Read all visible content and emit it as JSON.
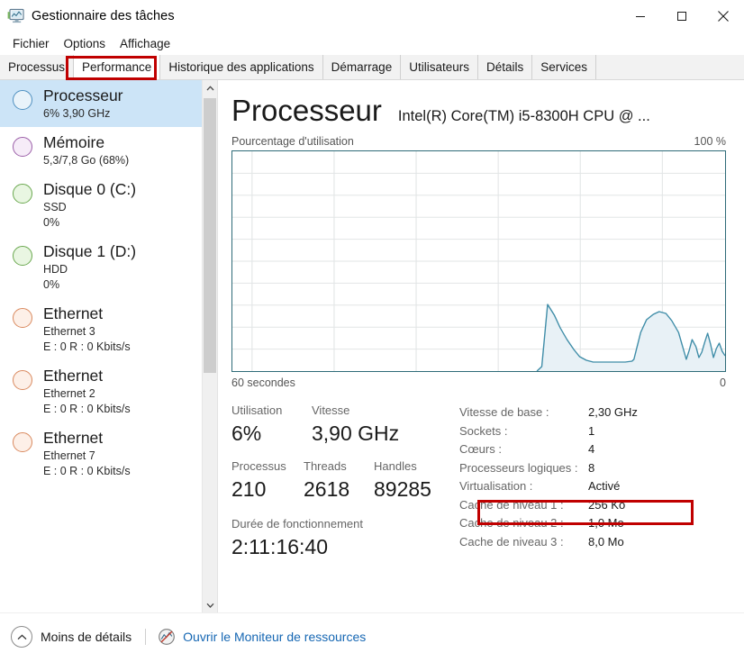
{
  "window": {
    "title": "Gestionnaire des tâches",
    "icon": "task-manager-monitor-icon",
    "minimize": "—",
    "maximize": "□",
    "close": "✕"
  },
  "menu": {
    "items": [
      {
        "label": "Fichier"
      },
      {
        "label": "Options"
      },
      {
        "label": "Affichage"
      }
    ]
  },
  "tabs": {
    "items": [
      {
        "label": "Processus",
        "active": false
      },
      {
        "label": "Performance",
        "active": true
      },
      {
        "label": "Historique des applications",
        "active": false
      },
      {
        "label": "Démarrage",
        "active": false
      },
      {
        "label": "Utilisateurs",
        "active": false
      },
      {
        "label": "Détails",
        "active": false
      },
      {
        "label": "Services",
        "active": false
      }
    ]
  },
  "annotations": {
    "color": "#c00000",
    "boxes": [
      {
        "target": "Performance tab"
      },
      {
        "target": "Virtualisation row"
      }
    ]
  },
  "sidebar": {
    "items": [
      {
        "title": "Processeur",
        "sub1": "6%  3,90 GHz",
        "sub2": "",
        "color": "#4f90c0",
        "fill": "#e9f3fa",
        "selected": true
      },
      {
        "title": "Mémoire",
        "sub1": "5,3/7,8 Go (68%)",
        "sub2": "",
        "color": "#9b5fa8",
        "fill": "#f6ecf8",
        "selected": false
      },
      {
        "title": "Disque 0 (C:)",
        "sub1": "SSD",
        "sub2": "0%",
        "color": "#6aa84f",
        "fill": "#e9f6e2",
        "selected": false
      },
      {
        "title": "Disque 1 (D:)",
        "sub1": "HDD",
        "sub2": "0%",
        "color": "#6aa84f",
        "fill": "#e9f6e2",
        "selected": false
      },
      {
        "title": "Ethernet",
        "sub1": "Ethernet 3",
        "sub2": "E : 0 R : 0 Kbits/s",
        "color": "#d9895e",
        "fill": "#fdf0e8",
        "selected": false
      },
      {
        "title": "Ethernet",
        "sub1": "Ethernet 2",
        "sub2": "E : 0 R : 0 Kbits/s",
        "color": "#d9895e",
        "fill": "#fdf0e8",
        "selected": false
      },
      {
        "title": "Ethernet",
        "sub1": "Ethernet 7",
        "sub2": "E : 0 R : 0 Kbits/s",
        "color": "#d9895e",
        "fill": "#fdf0e8",
        "selected": false
      }
    ]
  },
  "panel": {
    "title": "Processeur",
    "model": "Intel(R) Core(TM) i5-8300H CPU @ ...",
    "graph_label": "Pourcentage d'utilisation",
    "graph_max": "100 %",
    "graph_time": "60 secondes",
    "graph_zero": "0",
    "stats": {
      "utilisation_label": "Utilisation",
      "utilisation_value": "6%",
      "vitesse_label": "Vitesse",
      "vitesse_value": "3,90 GHz",
      "processus_label": "Processus",
      "processus_value": "210",
      "threads_label": "Threads",
      "threads_value": "2618",
      "handles_label": "Handles",
      "handles_value": "89285",
      "uptime_label": "Durée de fonctionnement",
      "uptime_value": "2:11:16:40"
    },
    "specs": [
      {
        "key": "Vitesse de base :",
        "value": "2,30 GHz"
      },
      {
        "key": "Sockets :",
        "value": "1"
      },
      {
        "key": "Cœurs :",
        "value": "4"
      },
      {
        "key": "Processeurs logiques :",
        "value": "8"
      },
      {
        "key": "Virtualisation :",
        "value": "Activé"
      },
      {
        "key": "Cache de niveau 1 :",
        "value": "256 Ko"
      },
      {
        "key": "Cache de niveau 2 :",
        "value": "1,0 Mo"
      },
      {
        "key": "Cache de niveau 3 :",
        "value": "8,0 Mo"
      }
    ]
  },
  "chart_data": {
    "type": "area",
    "title": "Pourcentage d'utilisation",
    "xlabel": "60 secondes",
    "ylabel": "%",
    "ylim": [
      0,
      100
    ],
    "xlim": [
      60,
      0
    ],
    "grid": true,
    "legend": false,
    "line_color": "#3f8da8",
    "fill_color": "#e9f2f7",
    "axis_color": "#2e6b78",
    "x_tick_labels": [
      "60 secondes",
      "0"
    ],
    "y_tick_labels": [
      "100 %"
    ],
    "x": [
      0,
      2,
      4,
      6,
      8,
      10,
      12,
      14,
      16,
      18,
      20,
      22,
      24,
      26,
      28,
      30,
      32,
      34,
      36,
      38,
      40,
      42,
      44,
      46,
      48,
      50,
      52,
      54,
      56,
      58,
      59,
      60,
      61,
      62,
      63,
      64,
      65,
      66,
      67,
      68,
      69,
      70,
      71,
      72,
      73,
      74,
      75,
      76,
      77,
      78,
      79,
      80,
      81,
      82,
      83,
      84,
      85,
      86,
      87,
      88,
      89,
      90,
      91,
      92,
      93,
      94,
      95,
      96,
      97,
      98,
      99,
      100
    ],
    "values": [
      0,
      0,
      0,
      0,
      0,
      0,
      0,
      0,
      0,
      0,
      0,
      0,
      0,
      0,
      0,
      0,
      0,
      0,
      0,
      0,
      0,
      0,
      0,
      0,
      0,
      0,
      0,
      0,
      0,
      0,
      0,
      0,
      2,
      30,
      25,
      19,
      14,
      10,
      7,
      5,
      4,
      4,
      4,
      4,
      4,
      4,
      4,
      4,
      4,
      4,
      4,
      5,
      18,
      24,
      26,
      27,
      26,
      23,
      18,
      12,
      6,
      15,
      11,
      5,
      10,
      16,
      8,
      4,
      10,
      12,
      7,
      6
    ]
  },
  "statusbar": {
    "less_details_icon": "chevron-up-circle-icon",
    "less_details_label": "Moins de détails",
    "resource_monitor_icon": "resource-monitor-icon",
    "resource_monitor_label": "Ouvrir le Moniteur de ressources",
    "link_color": "#1667b3"
  }
}
